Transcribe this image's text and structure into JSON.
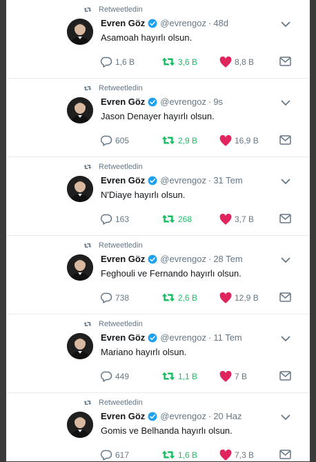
{
  "tweets": [
    {
      "retweet_label": "Retweetledin",
      "name": "Evren Göz",
      "handle": "@evrengoz",
      "sep": "·",
      "time": "48d",
      "text": "Asamoah hayırlı olsun.",
      "replies": "1,6 B",
      "retweets": "3,6 B",
      "likes": "8,8 B"
    },
    {
      "retweet_label": "Retweetledin",
      "name": "Evren Göz",
      "handle": "@evrengoz",
      "sep": "·",
      "time": "9s",
      "text": "Jason Denayer hayırlı olsun.",
      "replies": "605",
      "retweets": "2,9 B",
      "likes": "16,9 B"
    },
    {
      "retweet_label": "Retweetledin",
      "name": "Evren Göz",
      "handle": "@evrengoz",
      "sep": "·",
      "time": "31 Tem",
      "text": "N'Diaye hayırlı olsun.",
      "replies": "163",
      "retweets": "268",
      "likes": "3,7 B"
    },
    {
      "retweet_label": "Retweetledin",
      "name": "Evren Göz",
      "handle": "@evrengoz",
      "sep": "·",
      "time": "28 Tem",
      "text": "Feghouli ve Fernando hayırlı olsun.",
      "replies": "738",
      "retweets": "2,6 B",
      "likes": "12,9 B"
    },
    {
      "retweet_label": "Retweetledin",
      "name": "Evren Göz",
      "handle": "@evrengoz",
      "sep": "·",
      "time": "11 Tem",
      "text": "Mariano hayırlı olsun.",
      "replies": "449",
      "retweets": "1,1 B",
      "likes": "7 B"
    },
    {
      "retweet_label": "Retweetledin",
      "name": "Evren Göz",
      "handle": "@evrengoz",
      "sep": "·",
      "time": "20 Haz",
      "text": "Gomis ve Belhanda hayırlı olsun.",
      "replies": "617",
      "retweets": "1,6 B",
      "likes": "7,3 B"
    }
  ],
  "colors": {
    "retweet": "#17bf63",
    "like": "#e0245e",
    "verified": "#1da1f2",
    "muted": "#657786"
  },
  "icons": {
    "retweeted": "retweet-icon",
    "verified": "verified-badge-icon",
    "menu": "chevron-down-icon",
    "reply": "reply-icon",
    "retweet": "retweet-icon",
    "like": "heart-icon",
    "dm": "envelope-icon"
  }
}
